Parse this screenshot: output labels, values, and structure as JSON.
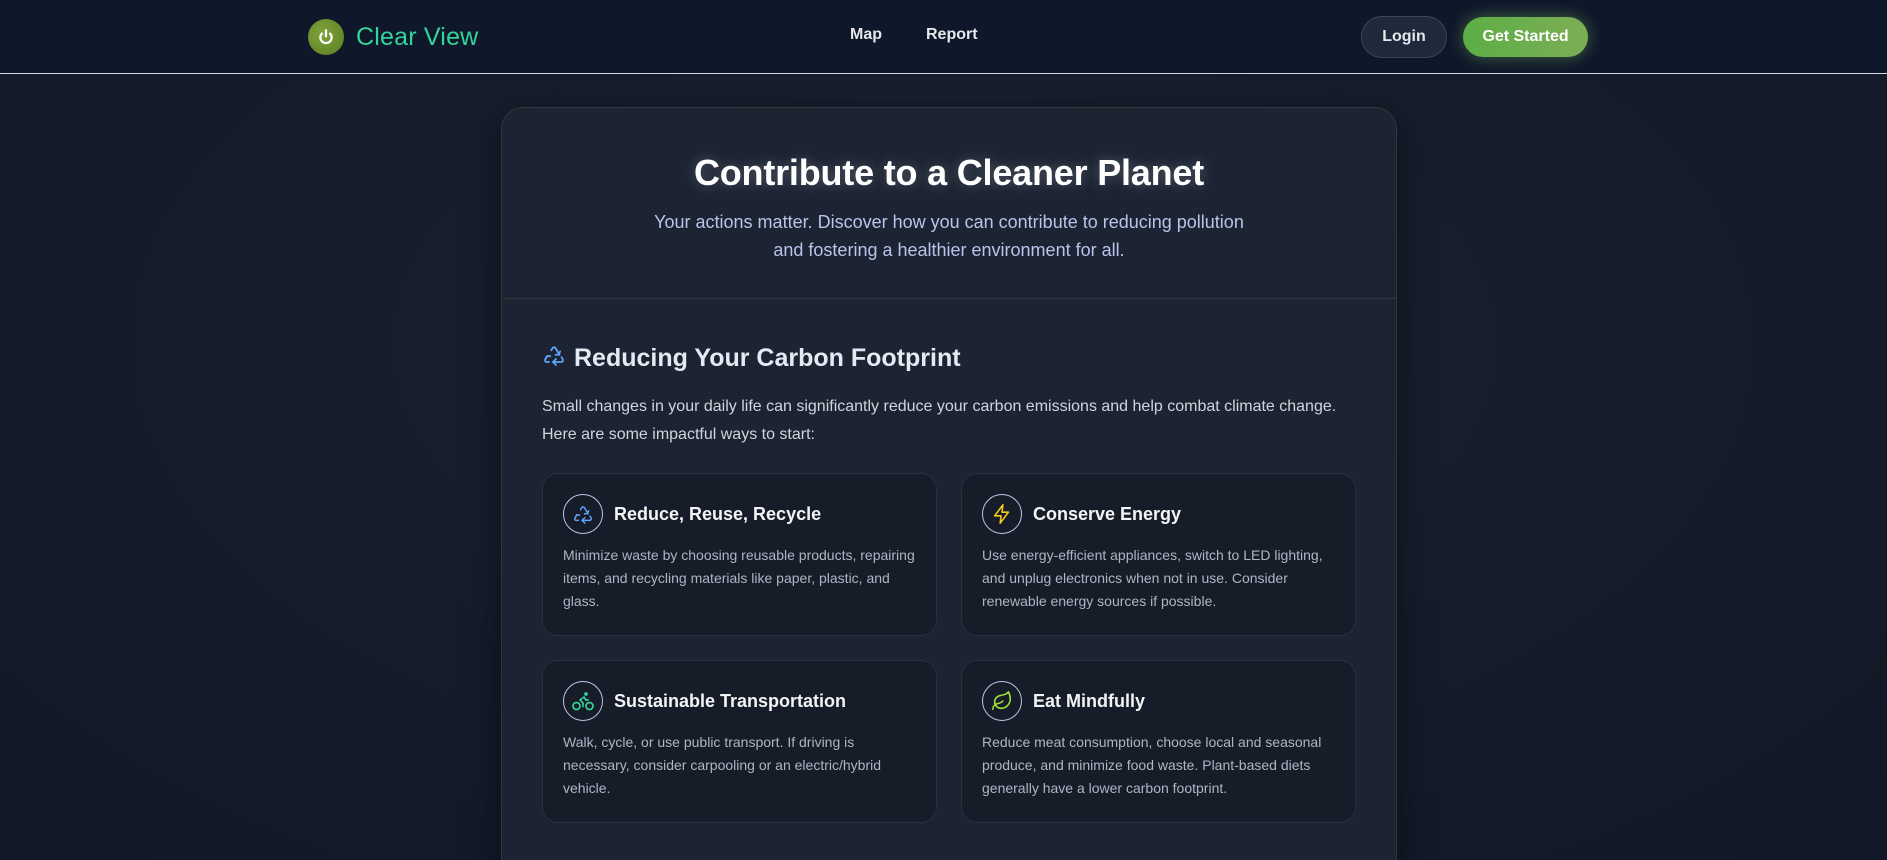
{
  "header": {
    "brand_name": "Clear View",
    "nav": [
      "Map",
      "Report"
    ],
    "login_label": "Login",
    "get_started_label": "Get Started"
  },
  "hero": {
    "title": "Contribute to a Cleaner Planet",
    "subtitle": "Your actions matter. Discover how you can contribute to reducing pollution and fostering a healthier environment for all."
  },
  "section": {
    "icon": "recycle-icon",
    "title": "Reducing Your Carbon Footprint",
    "intro": "Small changes in your daily life can significantly reduce your carbon emissions and help combat climate change. Here are some impactful ways to start:",
    "tips": [
      {
        "icon": "recycle-icon",
        "icon_color": "#60a5fa",
        "title": "Reduce, Reuse, Recycle",
        "description": "Minimize waste by choosing reusable products, repairing items, and recycling materials like paper, plastic, and glass."
      },
      {
        "icon": "lightning-icon",
        "icon_color": "#facc15",
        "title": "Conserve Energy",
        "description": "Use energy-efficient appliances, switch to LED lighting, and unplug electronics when not in use. Consider renewable energy sources if possible."
      },
      {
        "icon": "bicycle-icon",
        "icon_color": "#34d399",
        "title": "Sustainable Transportation",
        "description": "Walk, cycle, or use public transport. If driving is necessary, consider carpooling or an electric/hybrid vehicle."
      },
      {
        "icon": "leaf-icon",
        "icon_color": "#a3e635",
        "title": "Eat Mindfully",
        "description": "Reduce meat consumption, choose local and seasonal produce, and minimize food waste. Plant-based diets generally have a lower carbon footprint."
      }
    ]
  },
  "colors": {
    "brand_green": "#34d399",
    "accent_button": "#5cae46",
    "background": "#141b2b"
  }
}
